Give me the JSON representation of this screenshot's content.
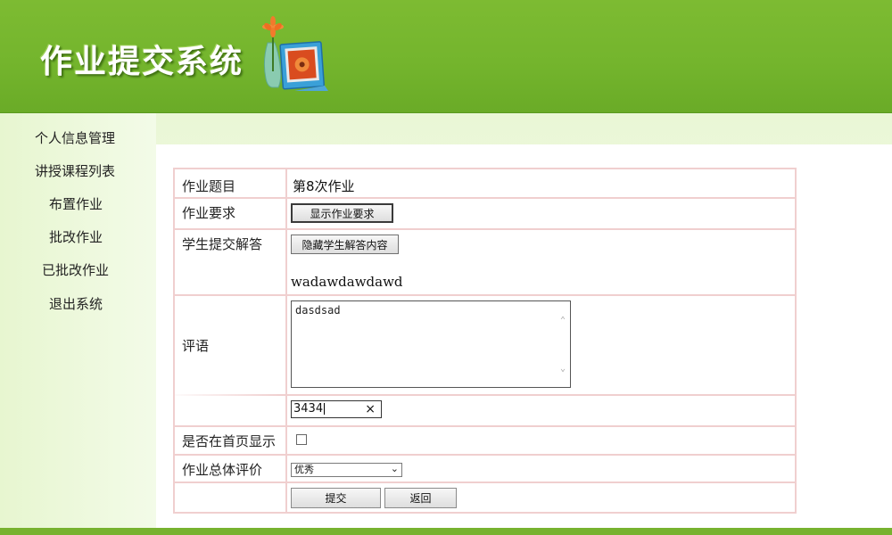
{
  "header": {
    "title": "作业提交系统",
    "logo_icon": "flower-photo-frame-icon"
  },
  "sidebar": {
    "items": [
      {
        "label": "个人信息管理"
      },
      {
        "label": "讲授课程列表"
      },
      {
        "label": "布置作业"
      },
      {
        "label": "批改作业"
      },
      {
        "label": "已批改作业"
      },
      {
        "label": "退出系统"
      }
    ]
  },
  "form": {
    "homework_title": {
      "label": "作业题目",
      "value": "第8次作业"
    },
    "homework_requirement": {
      "label": "作业要求",
      "button_label": "显示作业要求"
    },
    "student_answer": {
      "label": "学生提交解答",
      "button_label": "隐藏学生解答内容",
      "answer_text": "wadawdawdawd"
    },
    "comment": {
      "label": "评语",
      "value": "dasdsad"
    },
    "score": {
      "label": "",
      "value": "3434",
      "clear_label": "×"
    },
    "show_on_homepage": {
      "label": "是否在首页显示",
      "checked": false
    },
    "overall_rating": {
      "label": "作业总体评价",
      "selected": "优秀"
    },
    "submit_label": "提交",
    "back_label": "返回"
  },
  "colors": {
    "header_green": "#74b52d",
    "table_border": "#f0cfcf",
    "sidebar_bg": "#e7f6d0"
  }
}
